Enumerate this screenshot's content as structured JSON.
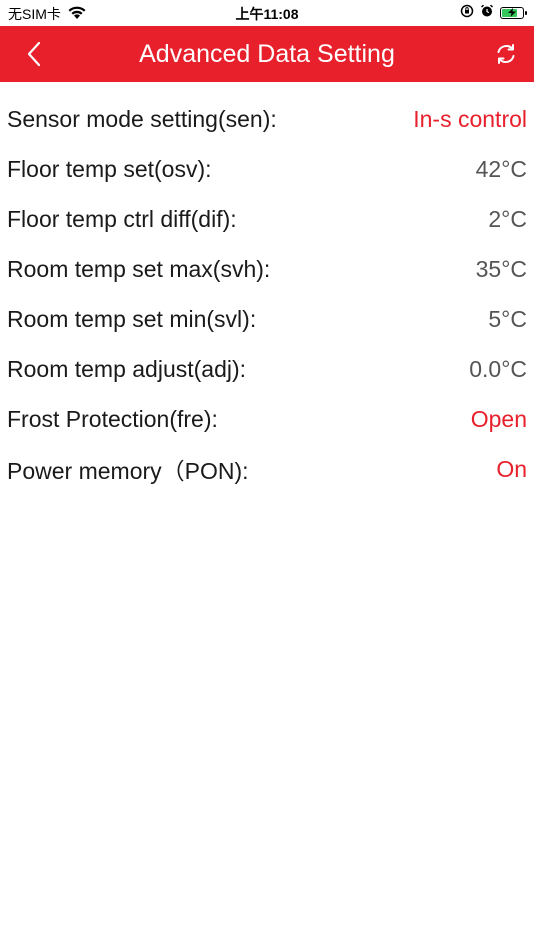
{
  "status_bar": {
    "carrier": "无SIM卡",
    "time": "上午11:08",
    "battery_level": 0.8
  },
  "nav": {
    "title": "Advanced Data Setting"
  },
  "colors": {
    "accent": "#e8202c",
    "value_gray": "#555555"
  },
  "settings": [
    {
      "label": "Sensor mode setting(sen):",
      "value": "In-s control",
      "accent": true
    },
    {
      "label": "Floor temp set(osv):",
      "value": "42°C",
      "accent": false
    },
    {
      "label": "Floor temp ctrl diff(dif):",
      "value": "2°C",
      "accent": false
    },
    {
      "label": "Room temp set max(svh):",
      "value": "35°C",
      "accent": false
    },
    {
      "label": "Room temp set min(svl):",
      "value": "5°C",
      "accent": false
    },
    {
      "label": "Room temp adjust(adj):",
      "value": "0.0°C",
      "accent": false
    },
    {
      "label": "Frost Protection(fre):",
      "value": "Open",
      "accent": true
    },
    {
      "label": "Power memory（PON):",
      "value": "On",
      "accent": true
    }
  ]
}
